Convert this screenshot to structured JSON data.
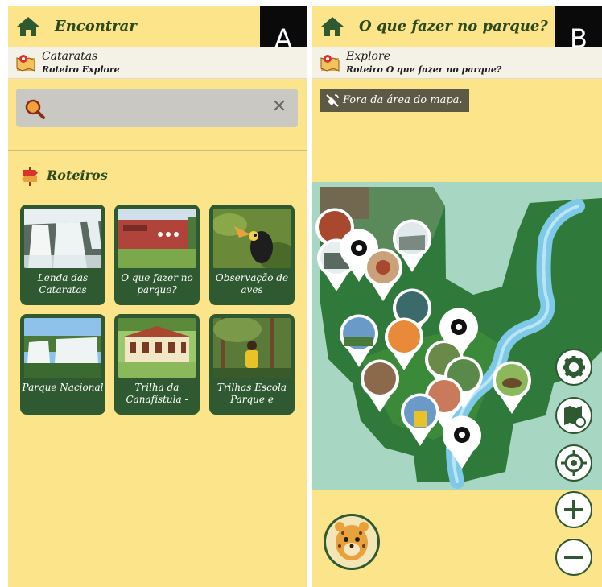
{
  "panel_a": {
    "header": {
      "title": "Encontrar",
      "badge": "A"
    },
    "route": {
      "title": "Cataratas",
      "subtitle": "Roteiro Explore"
    },
    "search": {
      "placeholder": "",
      "value": ""
    },
    "section": {
      "title": "Roteiros"
    },
    "cards": [
      {
        "label": "Lenda das Cataratas",
        "image": "waterfall"
      },
      {
        "label": "O que fazer no parque?",
        "image": "building"
      },
      {
        "label": "Observação de aves",
        "image": "toucan"
      },
      {
        "label": "Parque Nacional",
        "image": "falls-rainbow"
      },
      {
        "label": "Trilha da Canafístula -",
        "image": "house"
      },
      {
        "label": "Trilhas Escola Parque e",
        "image": "forest-person"
      }
    ]
  },
  "panel_b": {
    "header": {
      "title": "O que fazer no parque?",
      "badge": "B"
    },
    "route": {
      "title": "Explore",
      "subtitle": "Roteiro O que fazer no parque?"
    },
    "gps_notice": "Fora da área do mapa.",
    "controls": [
      "settings-icon",
      "map-refresh-icon",
      "locate-icon",
      "zoom-in-icon",
      "zoom-out-icon"
    ],
    "mascot": "jaguar"
  },
  "colors": {
    "background": "#fbe48a",
    "card": "#2f5a31",
    "title": "#2c4a1c",
    "map_water": "#a7d6c3",
    "map_forest": "#2f7a3a",
    "river": "#7ec8e8"
  }
}
